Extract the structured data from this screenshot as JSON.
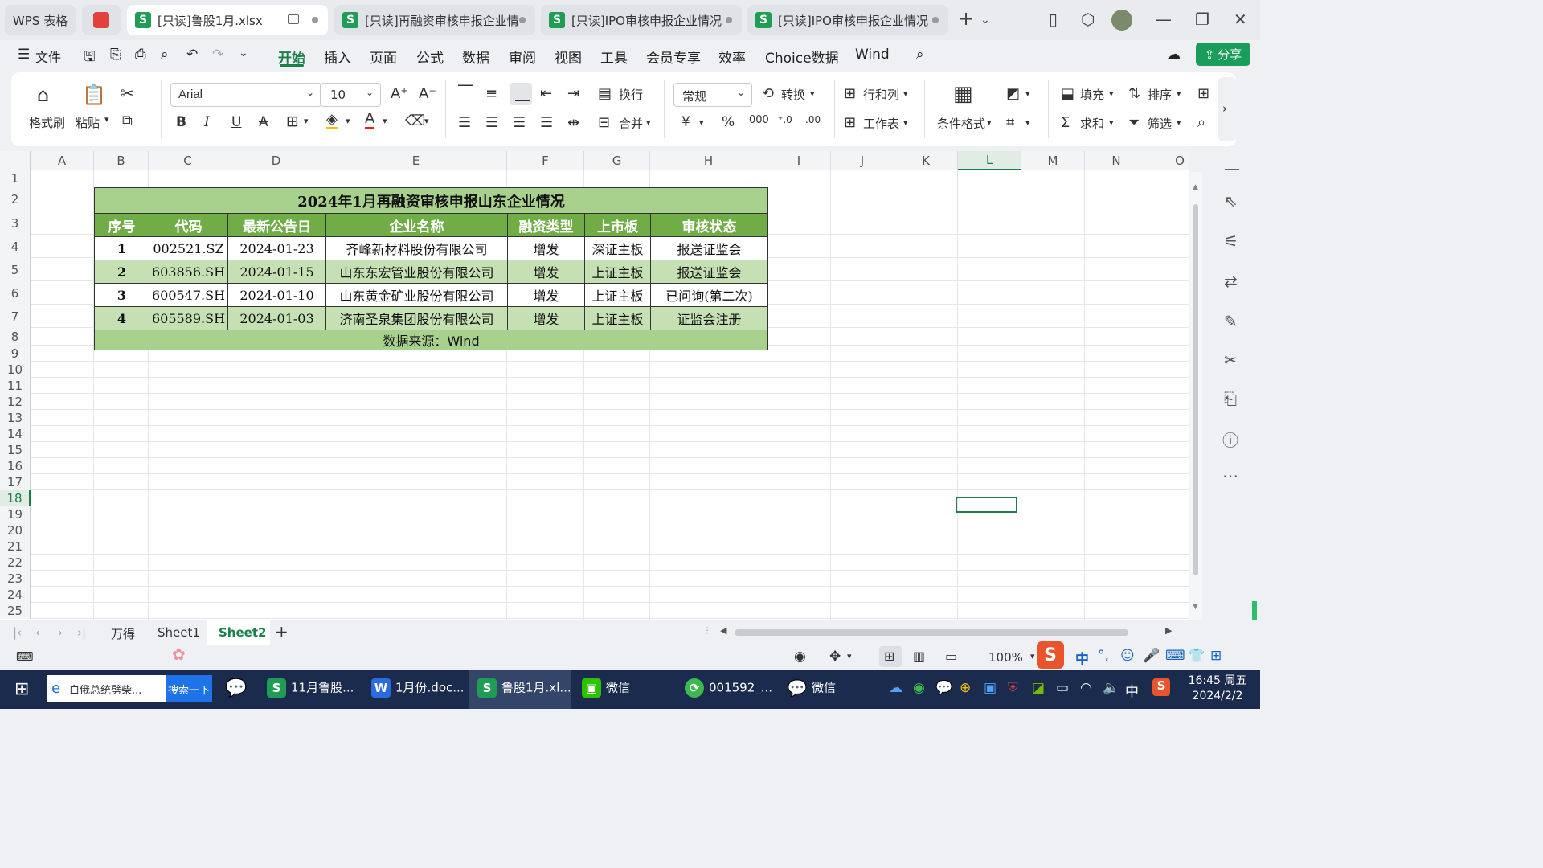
{
  "window": {
    "app_tab": "WPS 表格",
    "tabs": [
      {
        "label": "[只读]鲁股1月.xlsx",
        "active": true
      },
      {
        "label": "[只读]再融资审核申报企业情",
        "active": false
      },
      {
        "label": "[只读]IPO审核申报企业情况",
        "active": false
      },
      {
        "label": "[只读]IPO审核申报企业情况",
        "active": false
      }
    ]
  },
  "menu": {
    "file": "文件",
    "items": [
      "开始",
      "插入",
      "页面",
      "公式",
      "数据",
      "审阅",
      "视图",
      "工具",
      "会员专享",
      "效率",
      "Choice数据",
      "Wind"
    ],
    "active": "开始",
    "share": "分享"
  },
  "ribbon": {
    "format_painter": "格式刷",
    "paste": "粘贴",
    "font_name": "Arial",
    "font_size": "10",
    "wrap": "换行",
    "merge": "合并",
    "number_format": "常规",
    "convert": "转换",
    "row_col": "行和列",
    "worksheet": "工作表",
    "conditional": "条件格式",
    "fill": "填充",
    "sort": "排序",
    "sum": "求和",
    "filter": "筛选",
    "bold": "B",
    "italic": "I",
    "underline": "U"
  },
  "sheet": {
    "columns": [
      "A",
      "B",
      "C",
      "D",
      "E",
      "F",
      "G",
      "H",
      "I",
      "J",
      "K",
      "L",
      "M",
      "N",
      "O"
    ],
    "selected_column": "L",
    "rows": [
      "1",
      "2",
      "3",
      "4",
      "5",
      "6",
      "7",
      "8",
      "9",
      "10",
      "11",
      "12",
      "13",
      "14",
      "15",
      "16",
      "17",
      "18",
      "19",
      "20",
      "21",
      "22",
      "23",
      "24",
      "25"
    ],
    "selected_row": "18",
    "table": {
      "title": "2024年1月再融资审核申报山东企业情况",
      "headers": [
        "序号",
        "代码",
        "最新公告日",
        "企业名称",
        "融资类型",
        "上市板",
        "审核状态"
      ],
      "rows": [
        [
          "1",
          "002521.SZ",
          "2024-01-23",
          "齐峰新材料股份有限公司",
          "增发",
          "深证主板",
          "报送证监会"
        ],
        [
          "2",
          "603856.SH",
          "2024-01-15",
          "山东东宏管业股份有限公司",
          "增发",
          "上证主板",
          "报送证监会"
        ],
        [
          "3",
          "600547.SH",
          "2024-01-10",
          "山东黄金矿业股份有限公司",
          "增发",
          "上证主板",
          "已问询(第二次)"
        ],
        [
          "4",
          "605589.SH",
          "2024-01-03",
          "济南圣泉集团股份有限公司",
          "增发",
          "上证主板",
          "证监会注册"
        ]
      ],
      "source": "数据来源：Wind"
    }
  },
  "sheet_tabs": [
    "万得",
    "Sheet1",
    "Sheet2"
  ],
  "active_sheet": "Sheet2",
  "status": {
    "zoom": "100%"
  },
  "taskbar": {
    "search_text": "白俄总统劈柴...",
    "search_button": "搜索一下",
    "apps": [
      "11月鲁股...",
      "1月份.doc...",
      "鲁股1月.xl...",
      "微信",
      "001592_...",
      "微信"
    ],
    "ime": "中",
    "time": "16:45 周五",
    "date": "2024/2/2"
  },
  "colors": {
    "accent": "#1a7f4b",
    "header_green": "#70ad47",
    "title_green": "#a9d18e",
    "row_green": "#c5e0b3"
  }
}
